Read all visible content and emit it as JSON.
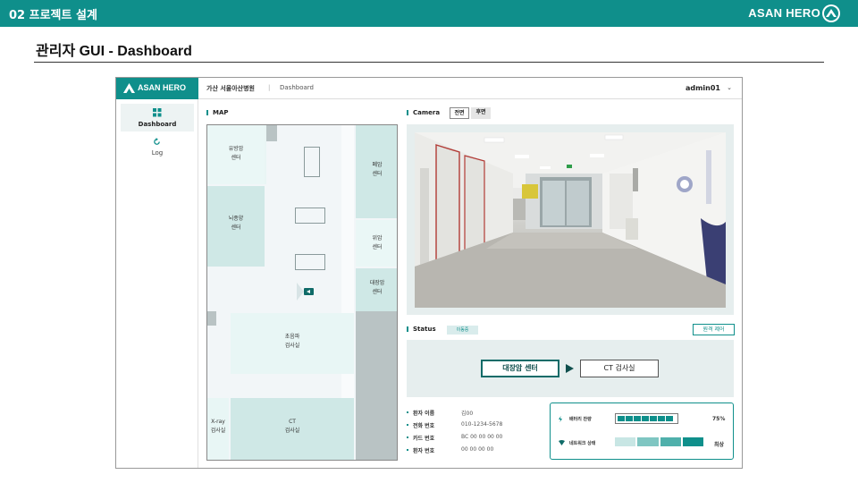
{
  "slide": {
    "section": "02 프로젝트 설계",
    "brand": "ASAN HERO",
    "title": "관리자 GUI - Dashboard"
  },
  "app": {
    "logo_text": "ASAN HERO",
    "hospital": "가산 서울아산병원",
    "breadcrumb_sep": "|",
    "breadcrumb": "Dashboard",
    "user": "admin01",
    "user_chevron": "⌄"
  },
  "sidebar": {
    "items": [
      {
        "label": "Dashboard",
        "icon": "grid-icon",
        "active": true
      },
      {
        "label": "Log",
        "icon": "refresh-icon",
        "active": false
      }
    ]
  },
  "map": {
    "title": "MAP",
    "rooms": [
      {
        "id": "breast",
        "lines": [
          "유방암",
          "센터"
        ]
      },
      {
        "id": "lung",
        "lines": [
          "폐암",
          "센터"
        ]
      },
      {
        "id": "brain",
        "lines": [
          "뇌종양",
          "센터"
        ]
      },
      {
        "id": "stomach",
        "lines": [
          "위암",
          "센터"
        ]
      },
      {
        "id": "colon",
        "lines": [
          "대장암",
          "센터"
        ]
      },
      {
        "id": "ultrasound",
        "lines": [
          "초음파",
          "검사실"
        ]
      },
      {
        "id": "xray",
        "lines": [
          "X-ray",
          "검사실"
        ]
      },
      {
        "id": "ct",
        "lines": [
          "CT",
          "검사실"
        ]
      }
    ]
  },
  "camera": {
    "title": "Camera",
    "tabs": [
      {
        "label": "전면",
        "active": true
      },
      {
        "label": "후면",
        "active": false
      }
    ]
  },
  "status": {
    "title": "Status",
    "state_tag": "이동중",
    "remote_button": "원격 제어",
    "route_from": "대장암 센터",
    "route_to": "CT 검사실"
  },
  "patient": [
    {
      "key": "환자 이름",
      "value": "김00"
    },
    {
      "key": "전화 번호",
      "value": "010-1234-5678"
    },
    {
      "key": "카드 번호",
      "value": "BC 00 00 00 00"
    },
    {
      "key": "환자 번호",
      "value": "00 00 00 00"
    }
  ],
  "robot": {
    "battery_label": "배터리 잔량",
    "battery_value": "75%",
    "battery_segments_filled": 7,
    "network_label": "네트워크 상태",
    "network_value": "최상",
    "network_level": 4
  },
  "colors": {
    "accent": "#0f8f8b",
    "room_fill": "#cfe8e6",
    "panel_bg": "#e6eeee"
  }
}
